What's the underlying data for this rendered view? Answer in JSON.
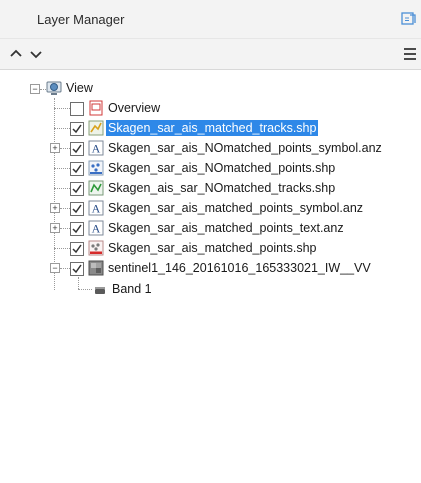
{
  "panel": {
    "title": "Layer Manager"
  },
  "toolbar": {
    "up_glyph": "^",
    "down_glyph": "v",
    "menu_glyph": "☰"
  },
  "tree": {
    "root_label": "View",
    "layers": [
      {
        "label": "Overview",
        "checked": false,
        "icon": "overview-icon",
        "expander": false
      },
      {
        "label": "Skagen_sar_ais_matched_tracks.shp",
        "checked": true,
        "icon": "line-shapefile-icon",
        "selected": true,
        "expander": false
      },
      {
        "label": "Skagen_sar_ais_NOmatched_points_symbol.anz",
        "checked": true,
        "icon": "annotation-icon",
        "expander": true
      },
      {
        "label": "Skagen_sar_ais_NOmatched_points.shp",
        "checked": true,
        "icon": "point-shapefile-icon",
        "expander": false
      },
      {
        "label": "Skagen_ais_sar_NOmatched_tracks.shp",
        "checked": true,
        "icon": "line-shapefile-icon",
        "expander": false
      },
      {
        "label": "Skagen_sar_ais_matched_points_symbol.anz",
        "checked": true,
        "icon": "annotation-icon",
        "expander": true
      },
      {
        "label": "Skagen_sar_ais_matched_points_text.anz",
        "checked": true,
        "icon": "annotation-icon",
        "expander": true
      },
      {
        "label": "Skagen_sar_ais_matched_points.shp",
        "checked": true,
        "icon": "point-shapefile-icon",
        "expander": false
      },
      {
        "label": "sentinel1_146_20161016_165333021_IW__VV",
        "checked": true,
        "icon": "raster-icon",
        "expander": true
      }
    ],
    "band": {
      "label": "Band 1",
      "icon": "band-icon"
    }
  }
}
